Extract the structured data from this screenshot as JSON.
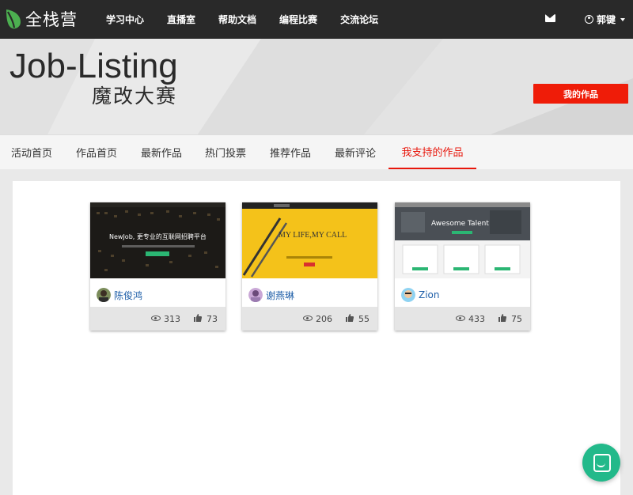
{
  "header": {
    "logo_text": "全栈营",
    "nav": [
      "学习中心",
      "直播室",
      "帮助文档",
      "编程比赛",
      "交流论坛"
    ],
    "username": "郭键"
  },
  "banner": {
    "title": "Job-Listing",
    "subtitle": "魔改大赛",
    "my_works_label": "我的作品"
  },
  "tabs": [
    "活动首页",
    "作品首页",
    "最新作品",
    "热门投票",
    "推荐作品",
    "最新评论",
    "我支持的作品"
  ],
  "active_tab": "我支持的作品",
  "cards": [
    {
      "author": "陈俊鸿",
      "views": "313",
      "likes": "73",
      "thumb_headline": "NewJob, 更专业的互联网招聘平台"
    },
    {
      "author": "谢燕琳",
      "views": "206",
      "likes": "55",
      "thumb_headline": "MY LIFE,MY CALL"
    },
    {
      "author": "Zion",
      "views": "433",
      "likes": "75",
      "thumb_headline": "Awesome Talent"
    }
  ],
  "colors": {
    "accent": "#ef1c08",
    "topbar": "#292929",
    "link": "#1f5fa8",
    "chat": "#22b98a"
  },
  "icons": [
    "leaf-logo-icon",
    "mail-icon",
    "user-icon",
    "chevron-down-icon",
    "eye-icon",
    "thumbs-up-icon",
    "chat-icon"
  ]
}
